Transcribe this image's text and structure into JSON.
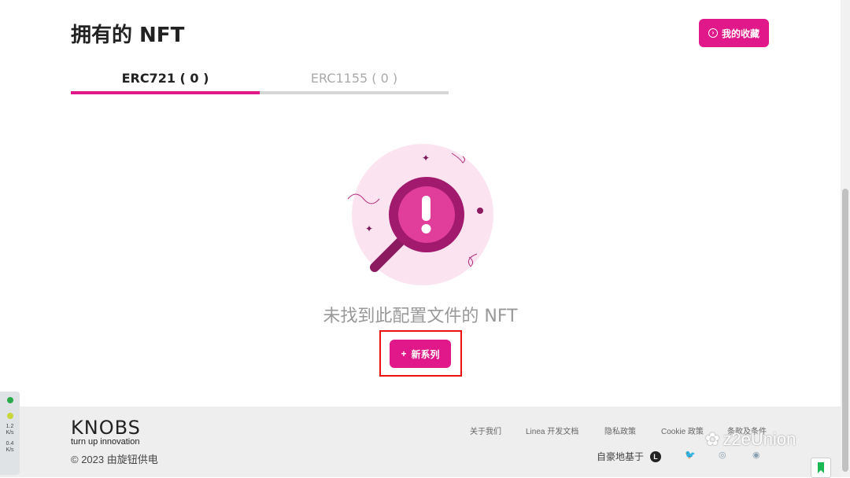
{
  "page": {
    "title": "拥有的 NFT",
    "favorites_label": "我的收藏"
  },
  "tabs": [
    {
      "label": "ERC721 ( 0 )",
      "active": true
    },
    {
      "label": "ERC1155 ( 0 )",
      "active": false
    }
  ],
  "empty": {
    "message": "未找到此配置文件的 NFT",
    "new_button_label": "新系列",
    "new_button_icon": "+"
  },
  "footer": {
    "brand": "KNOBS",
    "tagline": "turn up innovation",
    "copyright": "© 2023   由旋钮供电",
    "links": [
      "关于我们",
      "Linea 开发文档",
      "隐私政策",
      "Cookie 政策",
      "条款及条件"
    ],
    "built_on": "自豪地基于",
    "built_on_logo": "L",
    "social_icons": [
      "twitter-icon",
      "instagram-icon",
      "discord-icon"
    ]
  },
  "speed_widget": {
    "up": "1.2",
    "down": "0.4",
    "unit": "K/s"
  },
  "watermark": "z2eUnion",
  "colors": {
    "accent": "#e0188a",
    "highlight": "#e11111",
    "footer_bg": "#eeeeee"
  }
}
